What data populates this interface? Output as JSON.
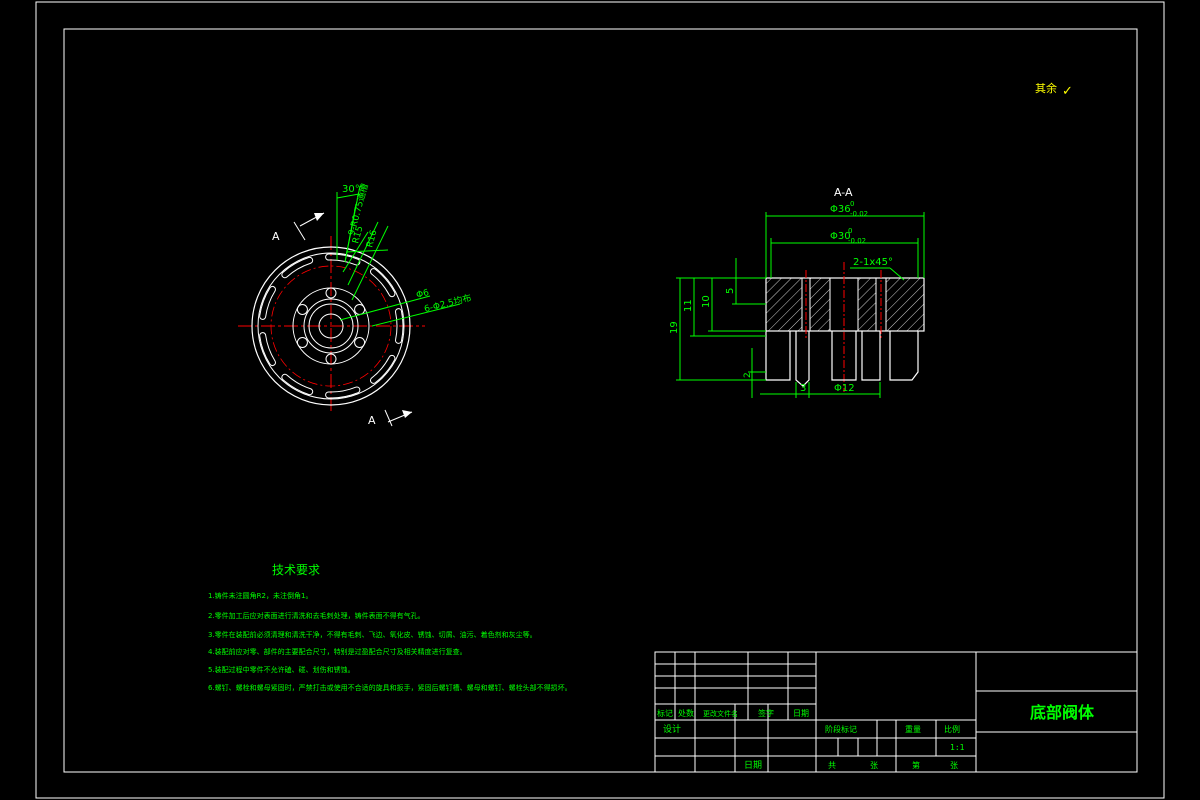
{
  "colors": {
    "background": "#000000",
    "frame": "#ffffff",
    "geometry": "#ffffff",
    "dimension": "#00ff00",
    "centerline": "#ff0000",
    "hatch": "#ffffff",
    "note_text": "#00ff00",
    "rough_mark": "#ffff00"
  },
  "surface_finish": {
    "label": "其余",
    "symbol": "✓"
  },
  "front_view": {
    "view_label_top": "A",
    "view_label_bottom": "A",
    "dims": {
      "angle": "30°",
      "slots": "9-R0.75通槽",
      "r1": "R15",
      "r2": "R16",
      "phi6": "Φ6",
      "holes": "6-Φ2.5均布"
    }
  },
  "section_view": {
    "title": "A-A",
    "dims": {
      "phi36": "Φ36",
      "phi36_tol_up": "0",
      "phi36_tol_low": "-0.02",
      "phi30": "Φ30",
      "phi30_tol_up": "0",
      "phi30_tol_low": "-0.02",
      "chamfer": "2-1x45°",
      "h19": "19",
      "h11": "11",
      "h10": "10",
      "h5": "5",
      "h2": "2",
      "w3": "3",
      "phi12": "Φ12"
    }
  },
  "notes": {
    "title": "技术要求",
    "items": [
      "1.铸件未注圆角R2，未注倒角1。",
      "2.零件加工后应对表面进行清洗和去毛刺处理，铸件表面不得有气孔。",
      "3.零件在装配前必须清理和清洗干净，不得有毛刺、飞边、氧化皮、锈蚀、切屑、油污、着色剂和灰尘等。",
      "4.装配前应对零、部件的主要配合尺寸，特别是过盈配合尺寸及相关精度进行复查。",
      "5.装配过程中零件不允许磕、碰、划伤和锈蚀。",
      "6.螺钉、螺栓和螺母紧固时，严禁打击或使用不合适的旋具和扳手，紧固后螺钉槽、螺母和螺钉、螺栓头部不得损坏。"
    ]
  },
  "title_block": {
    "part_name": "底部阀体",
    "row_headers": [
      "标记",
      "处数",
      "更改文件名",
      "签字",
      "日期"
    ],
    "designer": "设计",
    "date": "日期",
    "stage_headers": [
      "阶段标记",
      "重量",
      "比例"
    ],
    "scale": "1:1",
    "bottom_labels": [
      "共",
      "张",
      "第",
      "张"
    ]
  }
}
